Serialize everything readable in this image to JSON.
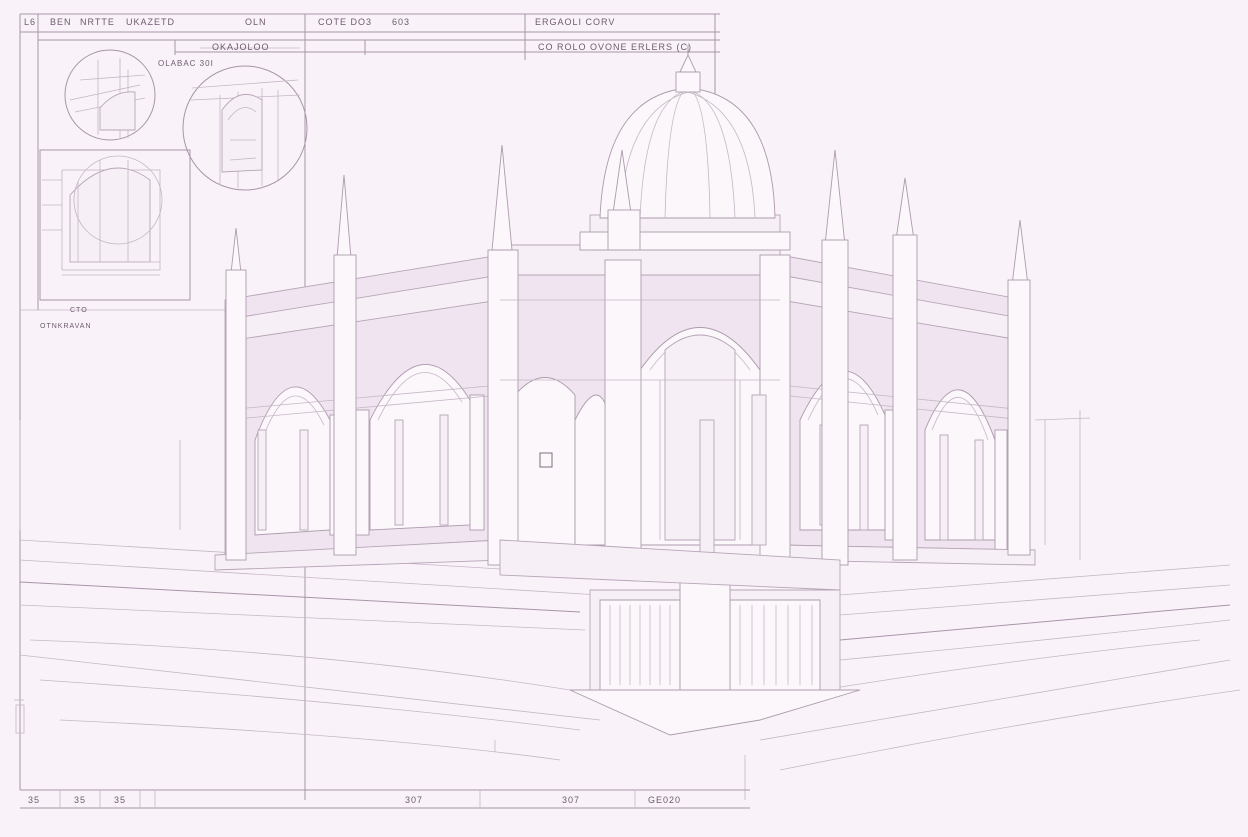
{
  "title_block": {
    "top_row": [
      "L6",
      "BEN",
      "NRTTE",
      "UKAZETD",
      "OLN",
      "COTE DO3",
      "603",
      "ERGAOLI CORV"
    ],
    "second_row": [
      "OKAJOLOO",
      "CO ROLO OVONE ERLERS (C)"
    ]
  },
  "detail_labels": {
    "detail_a": "OLABAC 30I",
    "side_note_1": "CTO",
    "side_note_2": "OTNKRAVAN"
  },
  "bottom_row": [
    "35",
    "35",
    "35",
    "307",
    "307",
    "GE020"
  ],
  "colors": {
    "paper": "#f9f3f9",
    "ink": "#a895a8",
    "ink_dark": "#6e5a6e"
  }
}
